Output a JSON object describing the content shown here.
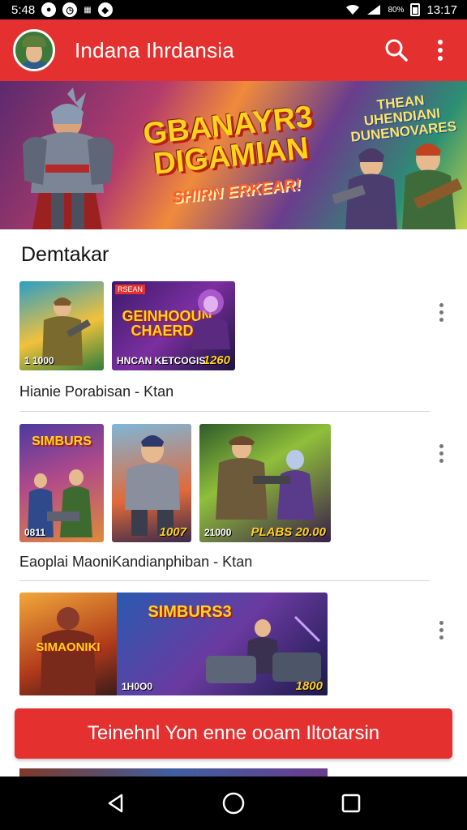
{
  "status_bar": {
    "time_left": "5:48",
    "battery_text": "80%",
    "time_right": "13:17"
  },
  "app_bar": {
    "title": "Indana Ihrdansia",
    "search_icon": "search-icon",
    "menu_icon": "more-vert-icon"
  },
  "banner": {
    "title_line1": "GBANAYR3",
    "title_line2": "DIGAMIAN",
    "subtitle": "SHIRN ERKEAR!",
    "side_text": "THEAN UHENDIANI DUNENOVARES"
  },
  "section": {
    "title": "Demtakar"
  },
  "rows": [
    {
      "label": "Hianie Porabisan - Ktan",
      "thumbs": [
        {
          "caption_left": "1 1000",
          "caption_right": ""
        },
        {
          "title": "GEINHOOUN CHAERDE",
          "caption_left": "HNCAN KETCOGIS",
          "caption_right": "1260",
          "tag": "RSEAN"
        }
      ]
    },
    {
      "label": "Eaoplai MaoniKandianphiban - Ktan",
      "thumbs": [
        {
          "title": "SIMBURS",
          "caption_left": "0811",
          "caption_right": ""
        },
        {
          "caption_left": "",
          "caption_right": "1007"
        },
        {
          "caption_left": "21000",
          "caption_right": "PLABS 20.00"
        }
      ]
    },
    {
      "label": "",
      "thumbs": [
        {
          "title": "SIMAONIKI",
          "caption_left": "",
          "caption_right": ""
        },
        {
          "title": "SIMBURS3",
          "caption_left": "1H0O0",
          "caption_right": "1800"
        }
      ]
    }
  ],
  "cta": {
    "label": "Teinehnl Yon enne ooam Iltotarsin"
  },
  "nav": {
    "back_icon": "back-triangle-icon",
    "home_icon": "home-circle-icon",
    "recents_icon": "recents-square-icon"
  },
  "colors": {
    "primary": "#e53030",
    "status_bar": "#000000",
    "divider": "#d6d6d6"
  }
}
